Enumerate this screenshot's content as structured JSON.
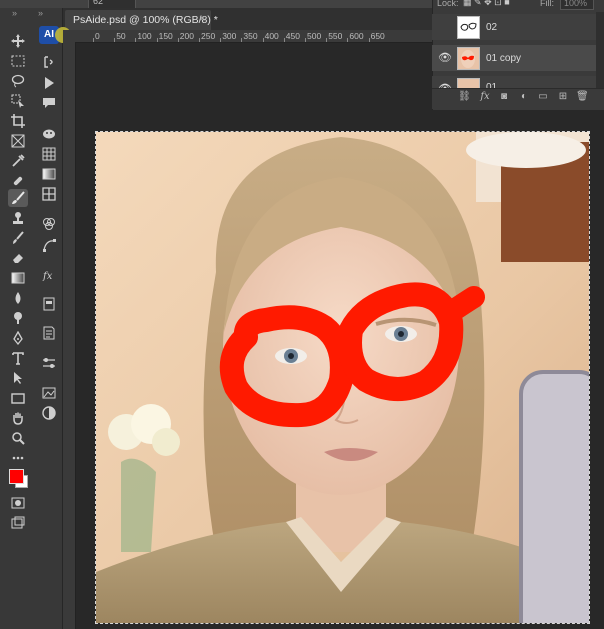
{
  "top_bar": {
    "field_value": "62"
  },
  "left_toolbar": {
    "collapse_glyph": "»",
    "tools": [
      "move-tool-icon",
      "marquee-tool-icon",
      "lasso-tool-icon",
      "object-select-tool-icon",
      "crop-tool-icon",
      "frame-tool-icon",
      "eyedropper-tool-icon",
      "healing-brush-icon",
      "brush-tool-icon",
      "clone-stamp-icon",
      "history-brush-icon",
      "eraser-tool-icon",
      "gradient-tool-icon",
      "blur-tool-icon",
      "dodge-tool-icon",
      "pen-tool-icon",
      "type-tool-icon",
      "path-select-icon",
      "rectangle-tool-icon",
      "hand-tool-icon",
      "zoom-tool-icon",
      "more-tools-icon"
    ],
    "foreground_color": "#ff0000",
    "background_color": "#ffffff"
  },
  "side_panel": {
    "collapse_glyph": "»",
    "ai_logo_text": "AI"
  },
  "document": {
    "tab_title": "PsAide.psd @ 100% (RGB/8) *",
    "close_glyph": "×"
  },
  "ruler": {
    "ticks": [
      "0",
      "50",
      "100",
      "150",
      "200",
      "250",
      "300",
      "350",
      "400",
      "450",
      "500",
      "550",
      "600",
      "650"
    ]
  },
  "layers_panel": {
    "lock_label": "Lock:",
    "fill_label": "Fill:",
    "fill_value": "100%",
    "layers": [
      {
        "name": "02",
        "visible": false
      },
      {
        "name": "01 copy",
        "visible": true
      },
      {
        "name": "01",
        "visible": true
      }
    ]
  },
  "colors": {
    "accent_red": "#ff1a00",
    "panel": "#3a3a3a",
    "workspace": "#282828"
  }
}
